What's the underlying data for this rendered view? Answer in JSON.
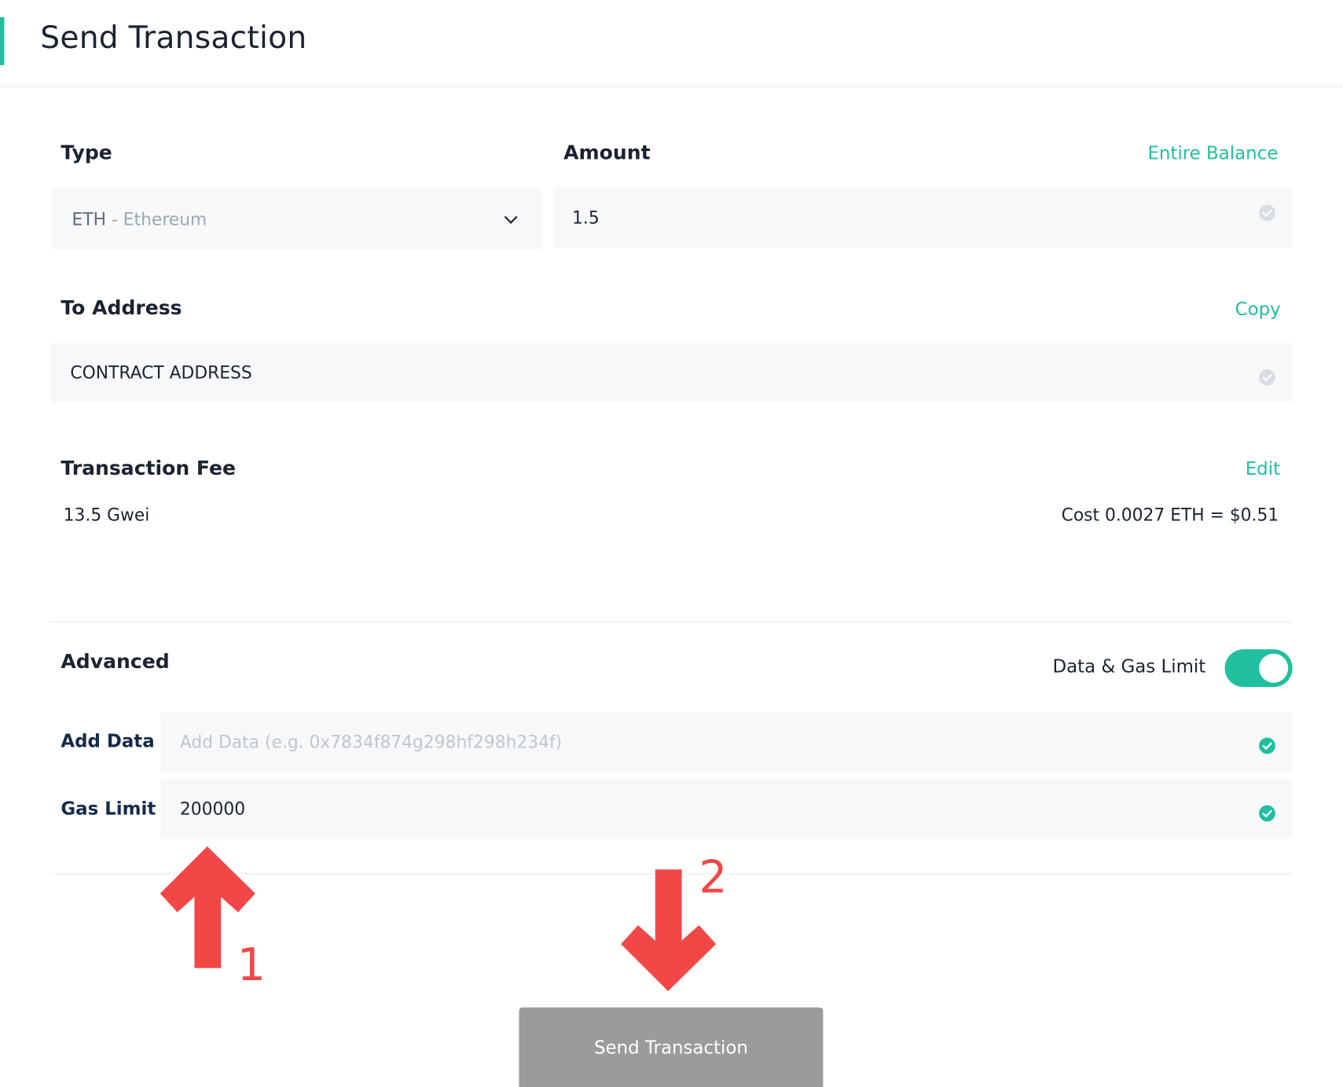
{
  "header": {
    "title": "Send Transaction"
  },
  "type": {
    "label": "Type",
    "selected_symbol": "ETH",
    "selected_name": " - Ethereum"
  },
  "amount": {
    "label": "Amount",
    "entire_balance_link": "Entire Balance",
    "value": "1.5"
  },
  "to_address": {
    "label": "To Address",
    "copy_link": "Copy",
    "value": "CONTRACT ADDRESS"
  },
  "fee": {
    "label": "Transaction Fee",
    "edit_link": "Edit",
    "gas_price": "13.5 Gwei",
    "cost": "Cost 0.0027 ETH = $0.51"
  },
  "advanced": {
    "label": "Advanced",
    "toggle_label": "Data & Gas Limit",
    "toggle_on": true,
    "add_data_label": "Add Data",
    "add_data_placeholder": "Add Data (e.g. 0x7834f874g298hf298h234f)",
    "gas_limit_label": "Gas Limit",
    "gas_limit_value": "200000"
  },
  "send_button": {
    "label": "Send Transaction"
  },
  "annotations": {
    "arrow_1_number": "1",
    "arrow_2_number": "2",
    "color": "#f24747"
  },
  "colors": {
    "accent": "#1fbf9f",
    "button_disabled": "#9b9b9b"
  },
  "icons": [
    "chevron-down-icon",
    "check-circle-icon",
    "arrow-up-icon",
    "arrow-down-icon"
  ]
}
